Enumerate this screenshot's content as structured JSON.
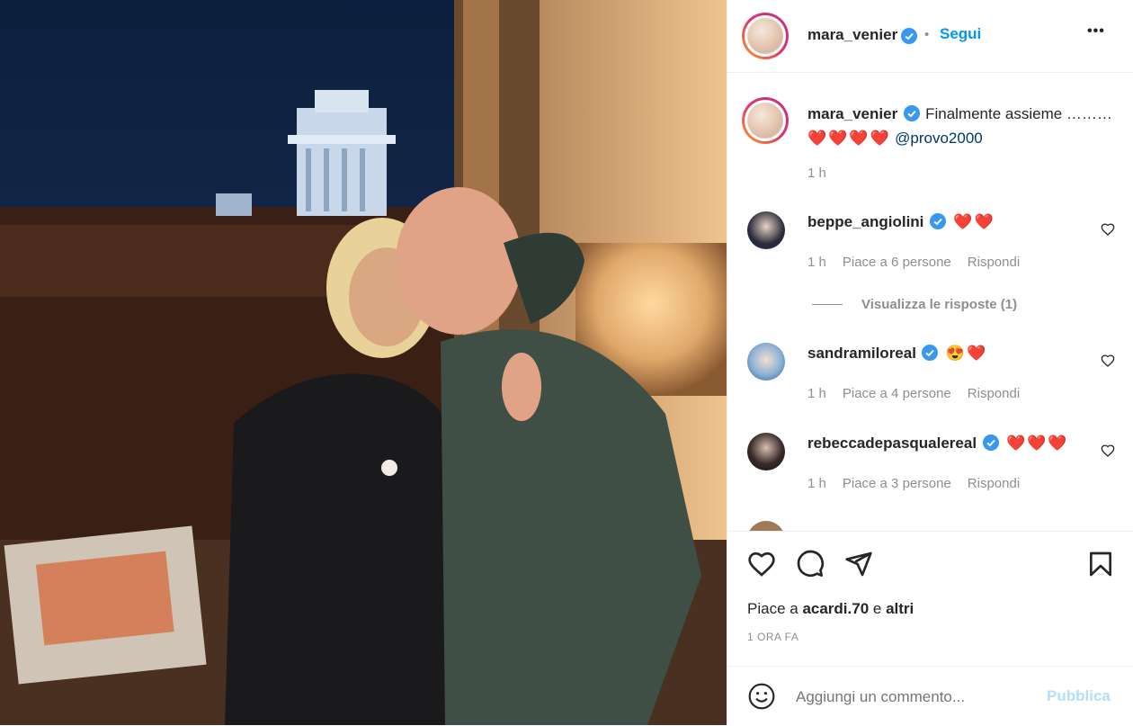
{
  "post": {
    "author": "mara_venier",
    "follow_label": "Segui",
    "separator": "•",
    "more_label": "•••",
    "caption_text": "Finalmente assieme ……… ",
    "caption_emoji": "❤️❤️❤️❤️",
    "caption_mention": "@provo2000",
    "caption_time": "1 h",
    "likes_prefix": "Piace a ",
    "likes_user": "acardi.70",
    "likes_suffix": " e ",
    "likes_others": "altri",
    "timestamp": "1 ORA FA"
  },
  "comments": [
    {
      "user": "beppe_angiolini",
      "text": "❤️❤️",
      "time": "1 h",
      "likes": "Piace a 6 persone",
      "reply": "Rispondi"
    },
    {
      "user": "sandramiloreal",
      "text": "😍❤️",
      "time": "1 h",
      "likes": "Piace a 4 persone",
      "reply": "Rispondi"
    },
    {
      "user": "rebeccadepasqualereal",
      "text": "❤️❤️❤️",
      "time": "1 h",
      "likes": "Piace a 3 persone",
      "reply": "Rispondi"
    }
  ],
  "view_replies": "Visualizza le risposte (1)",
  "add_comment": {
    "placeholder": "Aggiungi un commento...",
    "publish": "Pubblica"
  },
  "colors": {
    "accent": "#0095f6",
    "verified": "#3897f0",
    "heart": "#ed4956",
    "muted": "#8e8e8e"
  },
  "icons": [
    "heart-icon",
    "comment-icon",
    "share-icon",
    "bookmark-icon",
    "emoji-icon",
    "verified-badge-icon",
    "more-icon"
  ]
}
